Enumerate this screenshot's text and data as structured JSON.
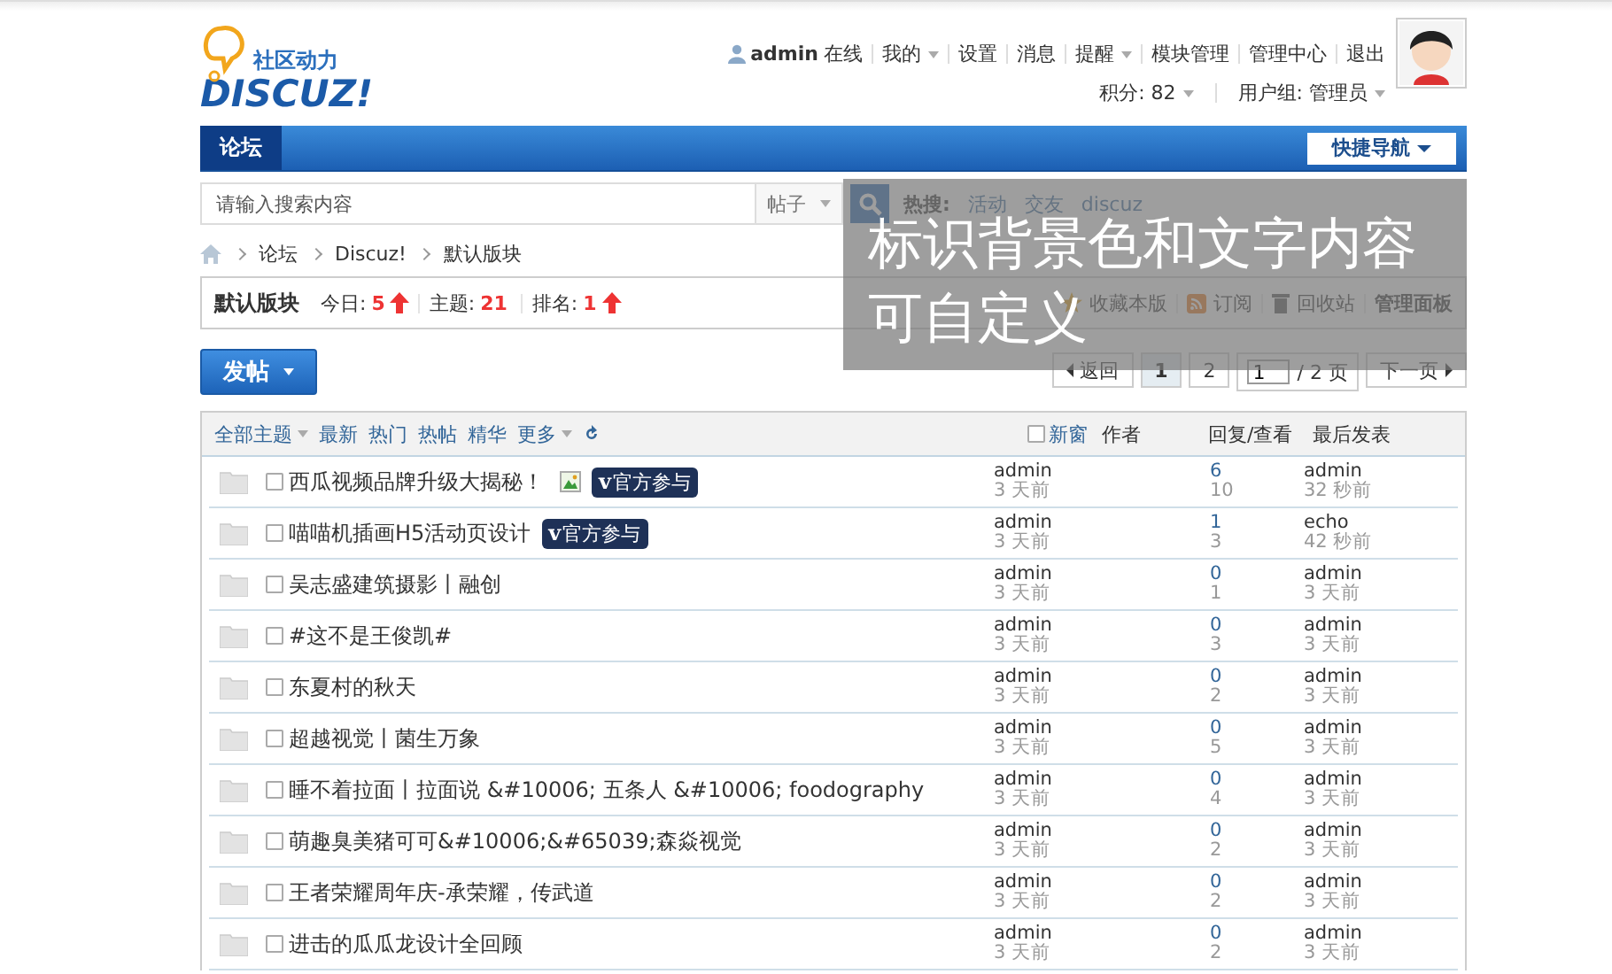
{
  "header": {
    "logo_tagline": "社区动力",
    "logo_text": "DISCUZ!",
    "user": "admin",
    "status": "在线",
    "links": [
      {
        "label": "我的",
        "dropdown": true
      },
      {
        "label": "设置",
        "dropdown": false
      },
      {
        "label": "消息",
        "dropdown": false
      },
      {
        "label": "提醒",
        "dropdown": true
      },
      {
        "label": "模块管理",
        "dropdown": false
      },
      {
        "label": "管理中心",
        "dropdown": false
      },
      {
        "label": "退出",
        "dropdown": false
      }
    ],
    "credits": "积分: 82",
    "usergroup": "用户组: 管理员"
  },
  "nav": {
    "items": [
      {
        "label": "论坛",
        "selected": true
      }
    ],
    "quick_nav": "快捷导航"
  },
  "search": {
    "placeholder": "请输入搜索内容",
    "type": "帖子",
    "hot_label": "热搜:",
    "hot": [
      "活动",
      "交友",
      "discuz"
    ]
  },
  "breadcrumb": [
    "论坛",
    "Discuz!",
    "默认版块"
  ],
  "forum": {
    "name": "默认版块",
    "stats": [
      {
        "label": "今日:",
        "value": "5",
        "rising": true
      },
      {
        "label": "主题:",
        "value": "21",
        "rising": false
      },
      {
        "label": "排名:",
        "value": "1",
        "rising": true
      }
    ],
    "actions": [
      {
        "kind": "favorite",
        "label": "收藏本版"
      },
      {
        "kind": "rss",
        "label": "订阅"
      },
      {
        "kind": "trash",
        "label": "回收站"
      },
      {
        "kind": "admin",
        "label": "管理面板"
      }
    ]
  },
  "post_button": "发帖",
  "pager": {
    "back": "返回",
    "pages": [
      {
        "label": "1",
        "selected": true
      },
      {
        "label": "2",
        "selected": false
      }
    ],
    "page_input": "1",
    "total": "/ 2 页",
    "next": "下一页"
  },
  "filters": [
    {
      "label": "全部主题",
      "dropdown": true
    },
    {
      "label": "最新",
      "dropdown": false
    },
    {
      "label": "热门",
      "dropdown": false
    },
    {
      "label": "热帖",
      "dropdown": false
    },
    {
      "label": "精华",
      "dropdown": false
    },
    {
      "label": "更多",
      "dropdown": true
    }
  ],
  "new_window": {
    "label": "新窗",
    "checked": false
  },
  "columns": [
    "作者",
    "回复/查看",
    "最后发表"
  ],
  "threads": [
    {
      "checked": false,
      "title": "西瓜视频品牌升级大揭秘！",
      "has_image": true,
      "badge": {
        "mark": "v",
        "label": "官方参与"
      },
      "author": "admin",
      "author_time": "3 天前",
      "replies": "6",
      "views": "10",
      "last_poster": "admin",
      "last_time": "32 秒前"
    },
    {
      "checked": false,
      "title": "喵喵机插画H5活动页设计",
      "has_image": false,
      "badge": {
        "mark": "v",
        "label": "官方参与"
      },
      "author": "admin",
      "author_time": "3 天前",
      "replies": "1",
      "views": "3",
      "last_poster": "echo",
      "last_time": "42 秒前"
    },
    {
      "checked": false,
      "title": "吴志盛建筑摄影丨融创",
      "has_image": false,
      "author": "admin",
      "author_time": "3 天前",
      "replies": "0",
      "views": "1",
      "last_poster": "admin",
      "last_time": "3 天前"
    },
    {
      "checked": false,
      "title": "#这不是王俊凯#",
      "has_image": false,
      "author": "admin",
      "author_time": "3 天前",
      "replies": "0",
      "views": "3",
      "last_poster": "admin",
      "last_time": "3 天前"
    },
    {
      "checked": false,
      "title": "东夏村的秋天",
      "has_image": false,
      "author": "admin",
      "author_time": "3 天前",
      "replies": "0",
      "views": "2",
      "last_poster": "admin",
      "last_time": "3 天前"
    },
    {
      "checked": false,
      "title": "超越视觉丨菌生万象",
      "has_image": false,
      "author": "admin",
      "author_time": "3 天前",
      "replies": "0",
      "views": "5",
      "last_poster": "admin",
      "last_time": "3 天前"
    },
    {
      "checked": false,
      "title": "睡不着拉面丨拉面说 &#10006; 五条人 &#10006; foodography",
      "has_image": false,
      "author": "admin",
      "author_time": "3 天前",
      "replies": "0",
      "views": "4",
      "last_poster": "admin",
      "last_time": "3 天前"
    },
    {
      "checked": false,
      "title": "萌趣臭美猪可可&#10006;&#65039;森焱视觉",
      "has_image": false,
      "author": "admin",
      "author_time": "3 天前",
      "replies": "0",
      "views": "2",
      "last_poster": "admin",
      "last_time": "3 天前"
    },
    {
      "checked": false,
      "title": "王者荣耀周年庆-承荣耀，传武道",
      "has_image": false,
      "author": "admin",
      "author_time": "3 天前",
      "replies": "0",
      "views": "2",
      "last_poster": "admin",
      "last_time": "3 天前"
    },
    {
      "checked": false,
      "title": "进击的瓜瓜龙设计全回顾",
      "has_image": false,
      "author": "admin",
      "author_time": "3 天前",
      "replies": "0",
      "views": "2",
      "last_poster": "admin",
      "last_time": "3 天前"
    }
  ],
  "overlay": {
    "text": "标识背景色和文字内容可自定义"
  }
}
